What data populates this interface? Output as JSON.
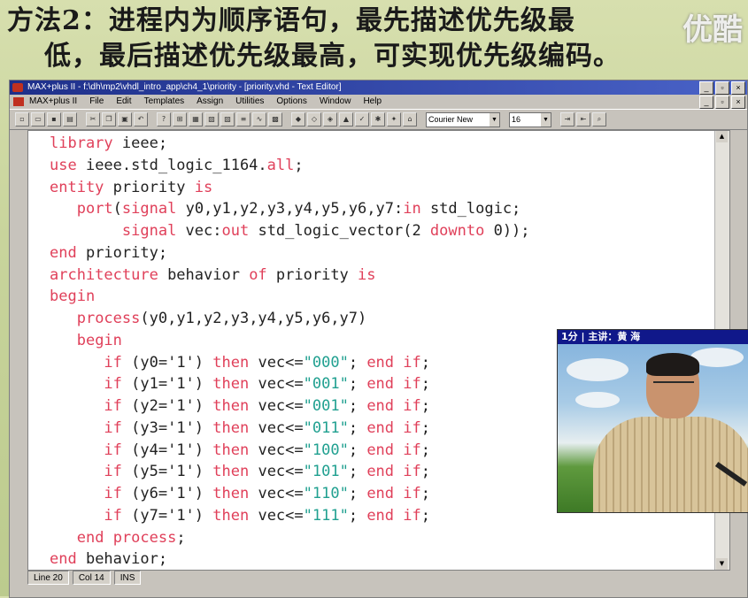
{
  "slide": {
    "heading_line1": "方法2：进程内为顺序语句，最先描述优先级最",
    "heading_line2": "低，最后描述优先级最高，可实现优先级编码。",
    "watermark": "优酷"
  },
  "window": {
    "title": "MAX+plus II - f:\\dh\\mp2\\vhdl_intro_app\\ch4_1\\priority - [priority.vhd - Text Editor]",
    "menu": [
      "MAX+plus II",
      "File",
      "Edit",
      "Templates",
      "Assign",
      "Utilities",
      "Options",
      "Window",
      "Help"
    ],
    "font_name": "Courier New",
    "font_size": "16",
    "win_buttons": [
      "_",
      "▫",
      "×"
    ]
  },
  "code": {
    "lines": [
      "library ieee;",
      "use ieee.std_logic_1164.all;",
      "entity priority is",
      "   port(signal y0,y1,y2,y3,y4,y5,y6,y7:in std_logic;",
      "        signal vec:out std_logic_vector(2 downto 0));",
      "end priority;",
      "architecture behavior of priority is",
      "begin",
      "   process(y0,y1,y2,y3,y4,y5,y6,y7)",
      "   begin",
      "      if (y0='1') then vec<=\"000\"; end if;",
      "      if (y1='1') then vec<=\"001\"; end if;",
      "      if (y2='1') then vec<=\"001\"; end if;",
      "      if (y3='1') then vec<=\"011\"; end if;",
      "      if (y4='1') then vec<=\"100\"; end if;",
      "      if (y5='1') then vec<=\"101\"; end if;",
      "      if (y6='1') then vec<=\"110\"; end if;",
      "      if (y7='1') then vec<=\"111\"; end if;",
      "   end process;",
      "end behavior;"
    ],
    "keywords": [
      "library",
      "use",
      "all",
      "entity",
      "is",
      "port",
      "signal",
      "in",
      "out",
      "downto",
      "end",
      "architecture",
      "of",
      "begin",
      "process",
      "if",
      "then"
    ]
  },
  "status": {
    "line": "Line  20",
    "col": "Col  14",
    "mode": "INS"
  },
  "video": {
    "caption": "1分 | 主讲：黄 海"
  },
  "colors": {
    "keyword": "#e0405a",
    "string": "#20a090",
    "titlebar": "#1e2f8a"
  }
}
